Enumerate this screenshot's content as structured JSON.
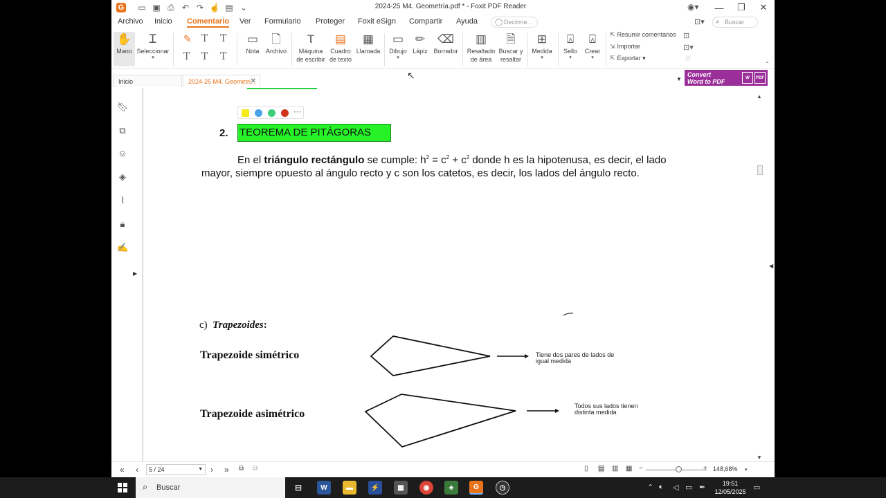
{
  "window": {
    "title": "2024-25 M4. Geometría.pdf * - Foxit PDF Reader",
    "logo": "G"
  },
  "menu": {
    "items": [
      "Archivo",
      "Inicio",
      "Comentario",
      "Ver",
      "Formulario",
      "Proteger",
      "Foxit eSign",
      "Compartir",
      "Ayuda"
    ],
    "active": "Comentario",
    "tell_me_placeholder": "Decirme...",
    "search_placeholder": "Buscar"
  },
  "ribbon": {
    "hand": "Mano",
    "select": "Seleccionar",
    "note": "Nota",
    "file": "Archivo",
    "typewriter_1": "Máquina",
    "typewriter_2": "de escribir",
    "textbox_1": "Cuadro",
    "textbox_2": "de texto",
    "callout": "Llamada",
    "drawing": "Dibujo",
    "pencil": "Lápiz",
    "eraser": "Borrador",
    "area_1": "Resaltado",
    "area_2": "de área",
    "search_1": "Buscar y",
    "search_2": "resaltar",
    "measure": "Medida",
    "stamp": "Sello",
    "create": "Crear",
    "summarize": "Resumir comentarios",
    "import": "Importar",
    "export": "Exportar"
  },
  "tabs": {
    "home": "Inicio",
    "document": "2024-25 M4. Geometri..."
  },
  "promo": {
    "line1": "Convert",
    "line2": "Word to PDF",
    "word_label": "W",
    "pdf_label": "PDF"
  },
  "document": {
    "section_number": "2.",
    "section_title": "TEOREMA DE PITÁGORAS",
    "para_line1_a": "En el ",
    "para_line1_b": "triángulo rectángulo",
    "para_line1_c": " se cumple: h",
    "para_sup1": "2",
    "para_line1_d": " = c",
    "para_sup2": "2",
    "para_line1_e": " + c",
    "para_sup3": "2",
    "para_line1_f": " donde h es la hipotenusa, es decir, el lado",
    "para_line2": "mayor, siempre opuesto al ángulo recto y c son los catetos, es decir, los lados del ángulo recto.",
    "trap_heading_prefix": "c)",
    "trap_heading": "Trapezoides",
    "trap_colon": ":",
    "sym_label": "Trapezoide simétrico",
    "sym_note_1": "Tiene dos pares de lados de",
    "sym_note_2": "igual medida",
    "asym_label": "Trapezoide asimétrico",
    "asym_note_1": "Todos sus lados tienen",
    "asym_note_2": "distinta medida"
  },
  "colors": {
    "accent": "#e8731a",
    "highlight": "#27f227",
    "swatch_yellow": "#f5ea1a",
    "swatch_blue": "#4aa3e8",
    "swatch_green": "#3ccf7a",
    "swatch_red": "#d0331c"
  },
  "statusbar": {
    "page": "5 / 24",
    "zoom": "148,68%"
  },
  "taskbar": {
    "search_placeholder": "Buscar",
    "time": "19:51",
    "date": "12/05/2025"
  }
}
